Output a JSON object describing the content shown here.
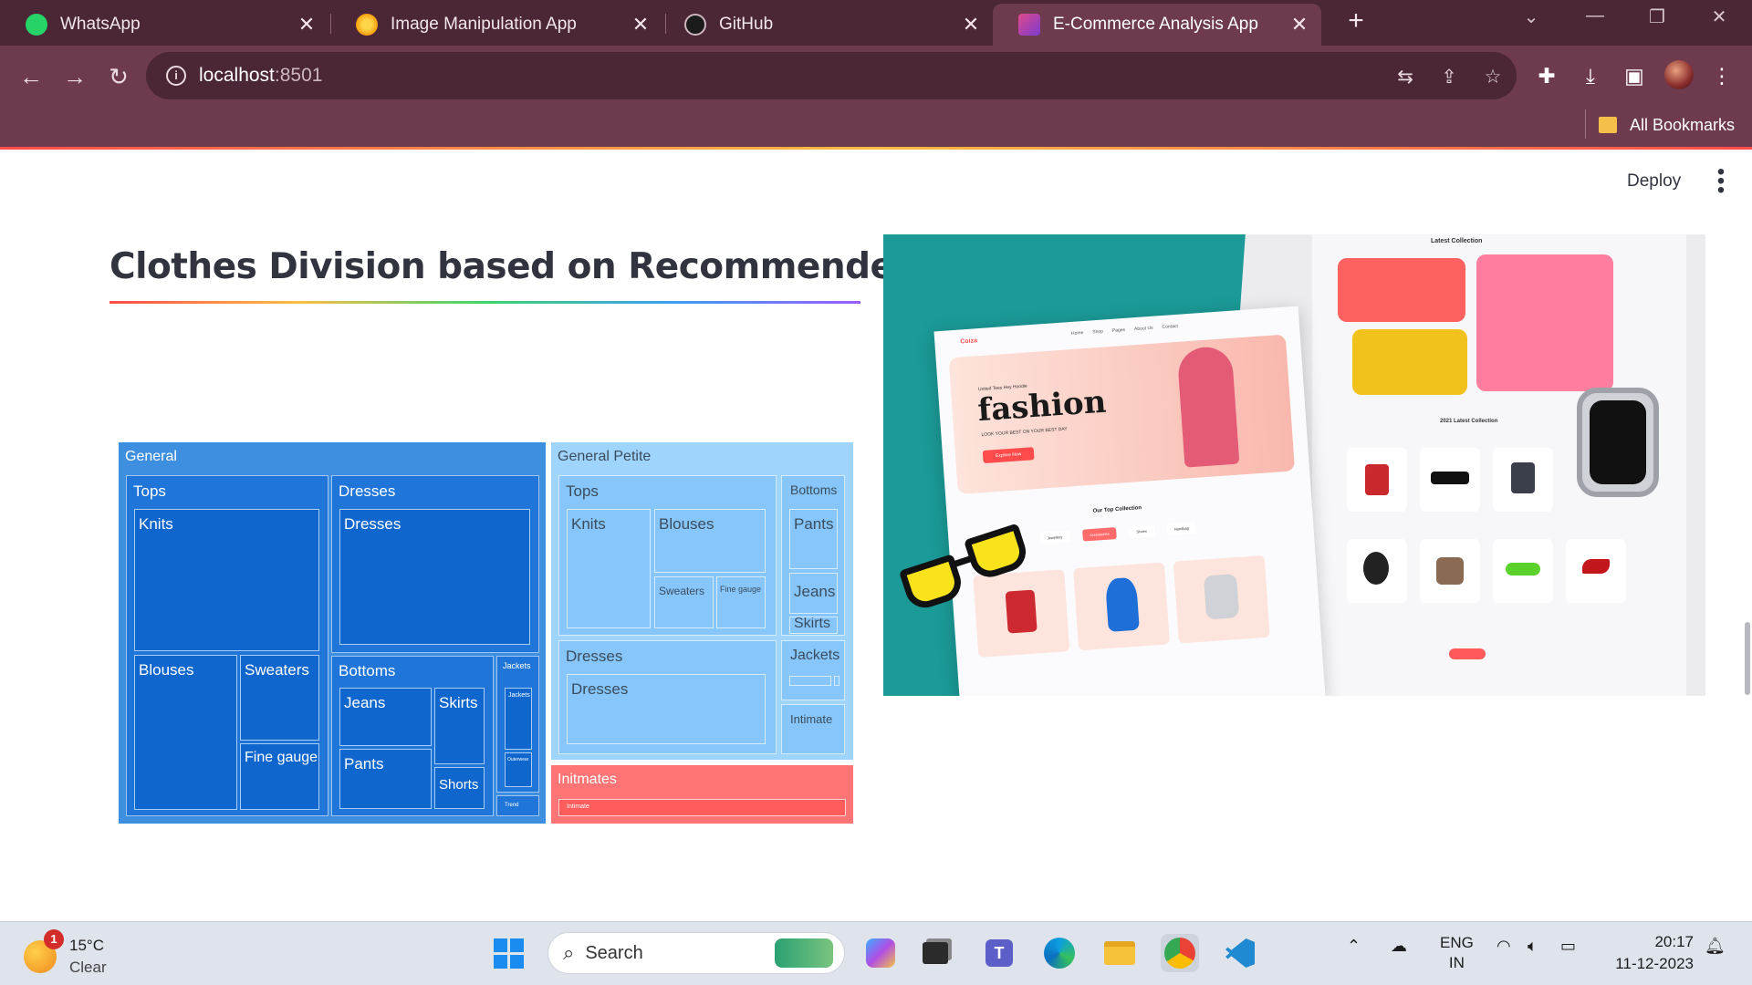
{
  "browser": {
    "tabs": [
      {
        "title": "WhatsApp",
        "icon": "whatsapp-icon",
        "active": false
      },
      {
        "title": "Image Manipulation App",
        "icon": "app-icon",
        "active": false
      },
      {
        "title": "GitHub",
        "icon": "github-icon",
        "active": false
      },
      {
        "title": "E-Commerce Analysis App",
        "icon": "ecommerce-icon",
        "active": true
      }
    ],
    "new_tab": "+",
    "address": {
      "host": "localhost",
      "port": ":8501"
    },
    "bookmarks_label": "All Bookmarks"
  },
  "app": {
    "deploy_label": "Deploy",
    "menu_icon": "⋮",
    "title": "Clothes Division based on Recommended IND"
  },
  "colors": {
    "accent": "#ff4b4b",
    "general": "#3e8fe0",
    "general_child": "#1f75d8",
    "general_leaf": "#0f66cc",
    "petite": "#9fd4fc",
    "petite_child": "#86c6fa",
    "intimates": "#ff7474"
  },
  "treemap": {
    "divisions": [
      {
        "name": "General",
        "departments": [
          {
            "name": "Tops",
            "classes": [
              "Knits",
              "Blouses",
              "Sweaters",
              "Fine gauge"
            ]
          },
          {
            "name": "Dresses",
            "classes": [
              "Dresses"
            ]
          },
          {
            "name": "Bottoms",
            "classes": [
              "Jeans",
              "Skirts",
              "Pants",
              "Shorts"
            ]
          },
          {
            "name": "Jackets",
            "classes": [
              "Jackets",
              "Outerwear"
            ]
          },
          {
            "name": "Trend",
            "classes": []
          }
        ]
      },
      {
        "name": "General Petite",
        "departments": [
          {
            "name": "Tops",
            "classes": [
              "Knits",
              "Blouses",
              "Sweaters",
              "Fine gauge"
            ]
          },
          {
            "name": "Bottoms",
            "classes": [
              "Pants",
              "Jeans",
              "Skirts"
            ]
          },
          {
            "name": "Dresses",
            "classes": [
              "Dresses"
            ]
          },
          {
            "name": "Jackets",
            "classes": []
          },
          {
            "name": "Intimate",
            "classes": []
          }
        ]
      },
      {
        "name": "Initmates",
        "departments": [
          {
            "name": "Intimate",
            "classes": []
          }
        ]
      }
    ]
  },
  "hero": {
    "brand": "Coiza",
    "headline": "fashion",
    "kicker": "United Tees Hey Hoodie",
    "tagline": "LOOK YOUR BEST ON YOUR BEST DAY",
    "cta": "Explore Now",
    "collection_title": "Our Top Collection",
    "latest_title": "2021 Latest Collection",
    "latest_header": "Latest Collection",
    "nav": [
      "Home",
      "Shop",
      "Pages",
      "About Us",
      "Contact"
    ],
    "chips": [
      "Jewellery",
      "Accessories",
      "Shoes",
      "Handbag"
    ]
  },
  "taskbar": {
    "weather_temp": "15°C",
    "weather_desc": "Clear",
    "weather_badge": "1",
    "search_placeholder": "Search",
    "lang_line1": "ENG",
    "lang_line2": "IN",
    "time": "20:17",
    "date": "11-12-2023"
  }
}
